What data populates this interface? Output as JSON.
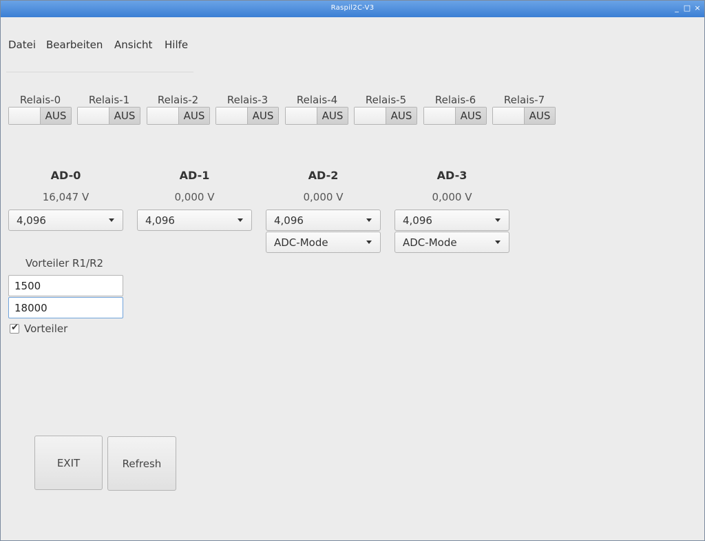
{
  "window": {
    "title": "Raspil2C-V3",
    "controls": [
      "_",
      "□",
      "×"
    ]
  },
  "menu": {
    "items": [
      "Datei",
      "Bearbeiten",
      "Ansicht",
      "Hilfe"
    ]
  },
  "relays": [
    {
      "label": "Relais-0",
      "state": "AUS"
    },
    {
      "label": "Relais-1",
      "state": "AUS"
    },
    {
      "label": "Relais-2",
      "state": "AUS"
    },
    {
      "label": "Relais-3",
      "state": "AUS"
    },
    {
      "label": "Relais-4",
      "state": "AUS"
    },
    {
      "label": "Relais-5",
      "state": "AUS"
    },
    {
      "label": "Relais-6",
      "state": "AUS"
    },
    {
      "label": "Relais-7",
      "state": "AUS"
    }
  ],
  "adcs": [
    {
      "title": "AD-0",
      "value": "16,047 V",
      "range": "4,096"
    },
    {
      "title": "AD-1",
      "value": "0,000 V",
      "range": "4,096"
    },
    {
      "title": "AD-2",
      "value": "0,000 V",
      "range": "4,096",
      "mode": "ADC-Mode"
    },
    {
      "title": "AD-3",
      "value": "0,000 V",
      "range": "4,096",
      "mode": "ADC-Mode"
    }
  ],
  "divider": {
    "label": "Vorteiler R1/R2",
    "r1": "1500",
    "r2": "18000",
    "checkbox_label": "Vorteiler",
    "checked": true
  },
  "buttons": {
    "exit": "EXIT",
    "refresh": "Refresh"
  },
  "colors": {
    "titlebar": "#3b7fd4",
    "background": "#ececec",
    "focus": "#6fa2da"
  }
}
